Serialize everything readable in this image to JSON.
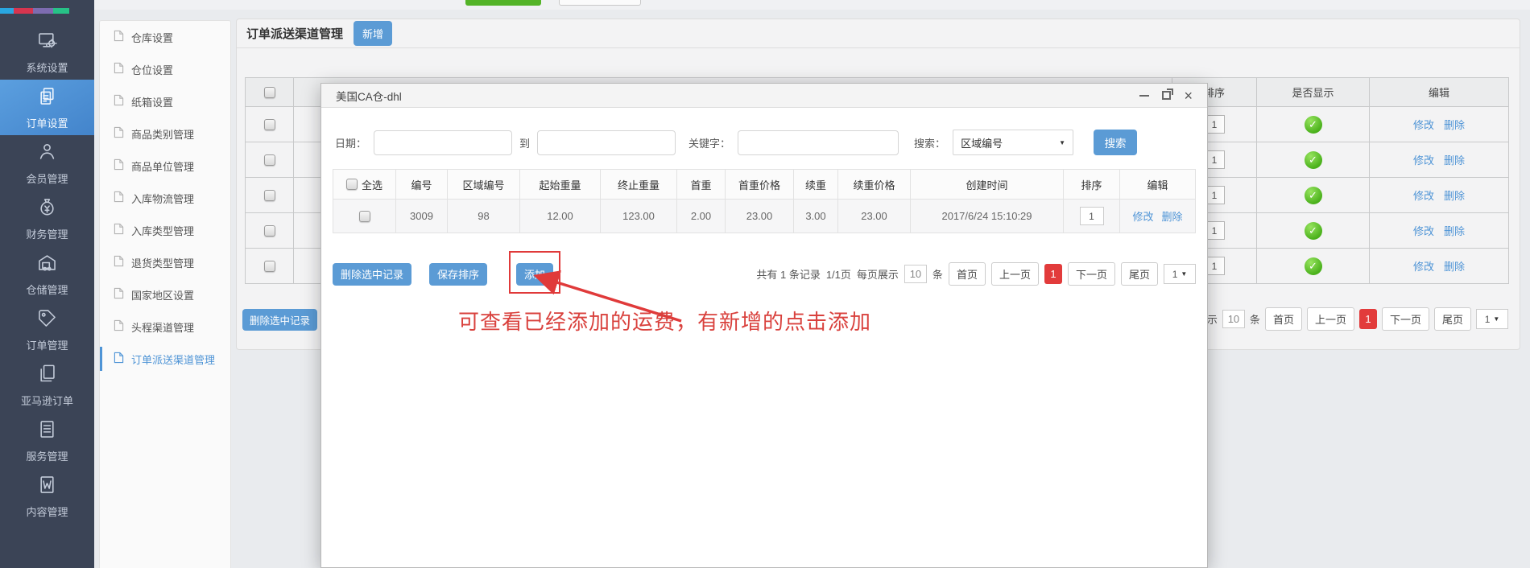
{
  "icons": {
    "check": "✓",
    "close": "×",
    "caret": "▼"
  },
  "colors": {
    "accent_blue": "#5b9bd5",
    "link_blue": "#4e94d6",
    "sidebar_dark": "#3b4456",
    "active_page_red": "#e23b3b",
    "annotation_red": "#d9413d",
    "check_green": "#49b01a",
    "stripe_blue": "#29a7e1",
    "stripe_red": "#d6354f",
    "stripe_purple": "#7d6cb0",
    "stripe_green": "#27c287"
  },
  "sidebar": {
    "items": [
      {
        "label": "系统设置",
        "icon": "monitor-gear-icon",
        "active": false
      },
      {
        "label": "订单设置",
        "icon": "clipboard-copy-icon",
        "active": true
      },
      {
        "label": "会员管理",
        "icon": "user-icon",
        "active": false
      },
      {
        "label": "财务管理",
        "icon": "money-bag-icon",
        "active": false
      },
      {
        "label": "仓储管理",
        "icon": "warehouse-truck-icon",
        "active": false
      },
      {
        "label": "订单管理",
        "icon": "tag-icon",
        "active": false
      },
      {
        "label": "亚马逊订单",
        "icon": "pages-icon",
        "active": false
      },
      {
        "label": "服务管理",
        "icon": "list-doc-icon",
        "active": false
      },
      {
        "label": "内容管理",
        "icon": "word-doc-icon",
        "active": false
      }
    ]
  },
  "submenu": {
    "items": [
      {
        "label": "仓库设置",
        "active": false
      },
      {
        "label": "仓位设置",
        "active": false
      },
      {
        "label": "纸箱设置",
        "active": false
      },
      {
        "label": "商品类别管理",
        "active": false
      },
      {
        "label": "商品单位管理",
        "active": false
      },
      {
        "label": "入库物流管理",
        "active": false
      },
      {
        "label": "入库类型管理",
        "active": false
      },
      {
        "label": "退货类型管理",
        "active": false
      },
      {
        "label": "国家地区设置",
        "active": false
      },
      {
        "label": "头程渠道管理",
        "active": false
      },
      {
        "label": "订单派送渠道管理",
        "active": true
      }
    ]
  },
  "main": {
    "title": "订单派送渠道管理",
    "add_button": "新增",
    "delete_selected_button": "删除选中记录",
    "table": {
      "right_headers": {
        "sort": "排序",
        "visible": "是否显示",
        "edit": "编辑"
      },
      "rows": [
        {
          "sort": "1",
          "modify": "修改",
          "delete": "删除"
        },
        {
          "sort": "1",
          "modify": "修改",
          "delete": "删除"
        },
        {
          "sort": "1",
          "modify": "修改",
          "delete": "删除"
        },
        {
          "sort": "1",
          "modify": "修改",
          "delete": "删除"
        },
        {
          "sort": "1",
          "modify": "修改",
          "delete": "删除"
        }
      ]
    },
    "pagination": {
      "per_page_label": "每页展示",
      "per_page": "10",
      "unit": "条",
      "first": "首页",
      "prev": "上一页",
      "page": "1",
      "next": "下一页",
      "last": "尾页",
      "jump": "1"
    }
  },
  "modal": {
    "title": "美国CA仓-dhl",
    "search": {
      "date_label": "日期：",
      "to_label": "到",
      "keyword_label": "关键字：",
      "search_label": "搜索：",
      "select_value": "区域编号",
      "button": "搜索"
    },
    "table": {
      "headers": [
        "全选",
        "编号",
        "区域编号",
        "起始重量",
        "终止重量",
        "首重",
        "首重价格",
        "续重",
        "续重价格",
        "创建时间",
        "排序",
        "编辑"
      ],
      "row": {
        "number": "3009",
        "region": "98",
        "start_weight": "12.00",
        "end_weight": "123.00",
        "first_weight": "2.00",
        "first_price": "23.00",
        "add_weight": "3.00",
        "add_price": "23.00",
        "created": "2017/6/24 15:10:29",
        "sort": "1",
        "modify": "修改",
        "delete": "删除"
      }
    },
    "buttons": {
      "delete_selected": "删除选中记录",
      "save_sort": "保存排序",
      "add": "添加"
    },
    "pagination": {
      "summary": "共有 1 条记录",
      "page_info": "1/1页",
      "per_page_label": "每页展示",
      "per_page": "10",
      "unit": "条",
      "first": "首页",
      "prev": "上一页",
      "page": "1",
      "next": "下一页",
      "last": "尾页",
      "jump": "1"
    },
    "annotation": "可查看已经添加的运费，有新增的点击添加"
  }
}
